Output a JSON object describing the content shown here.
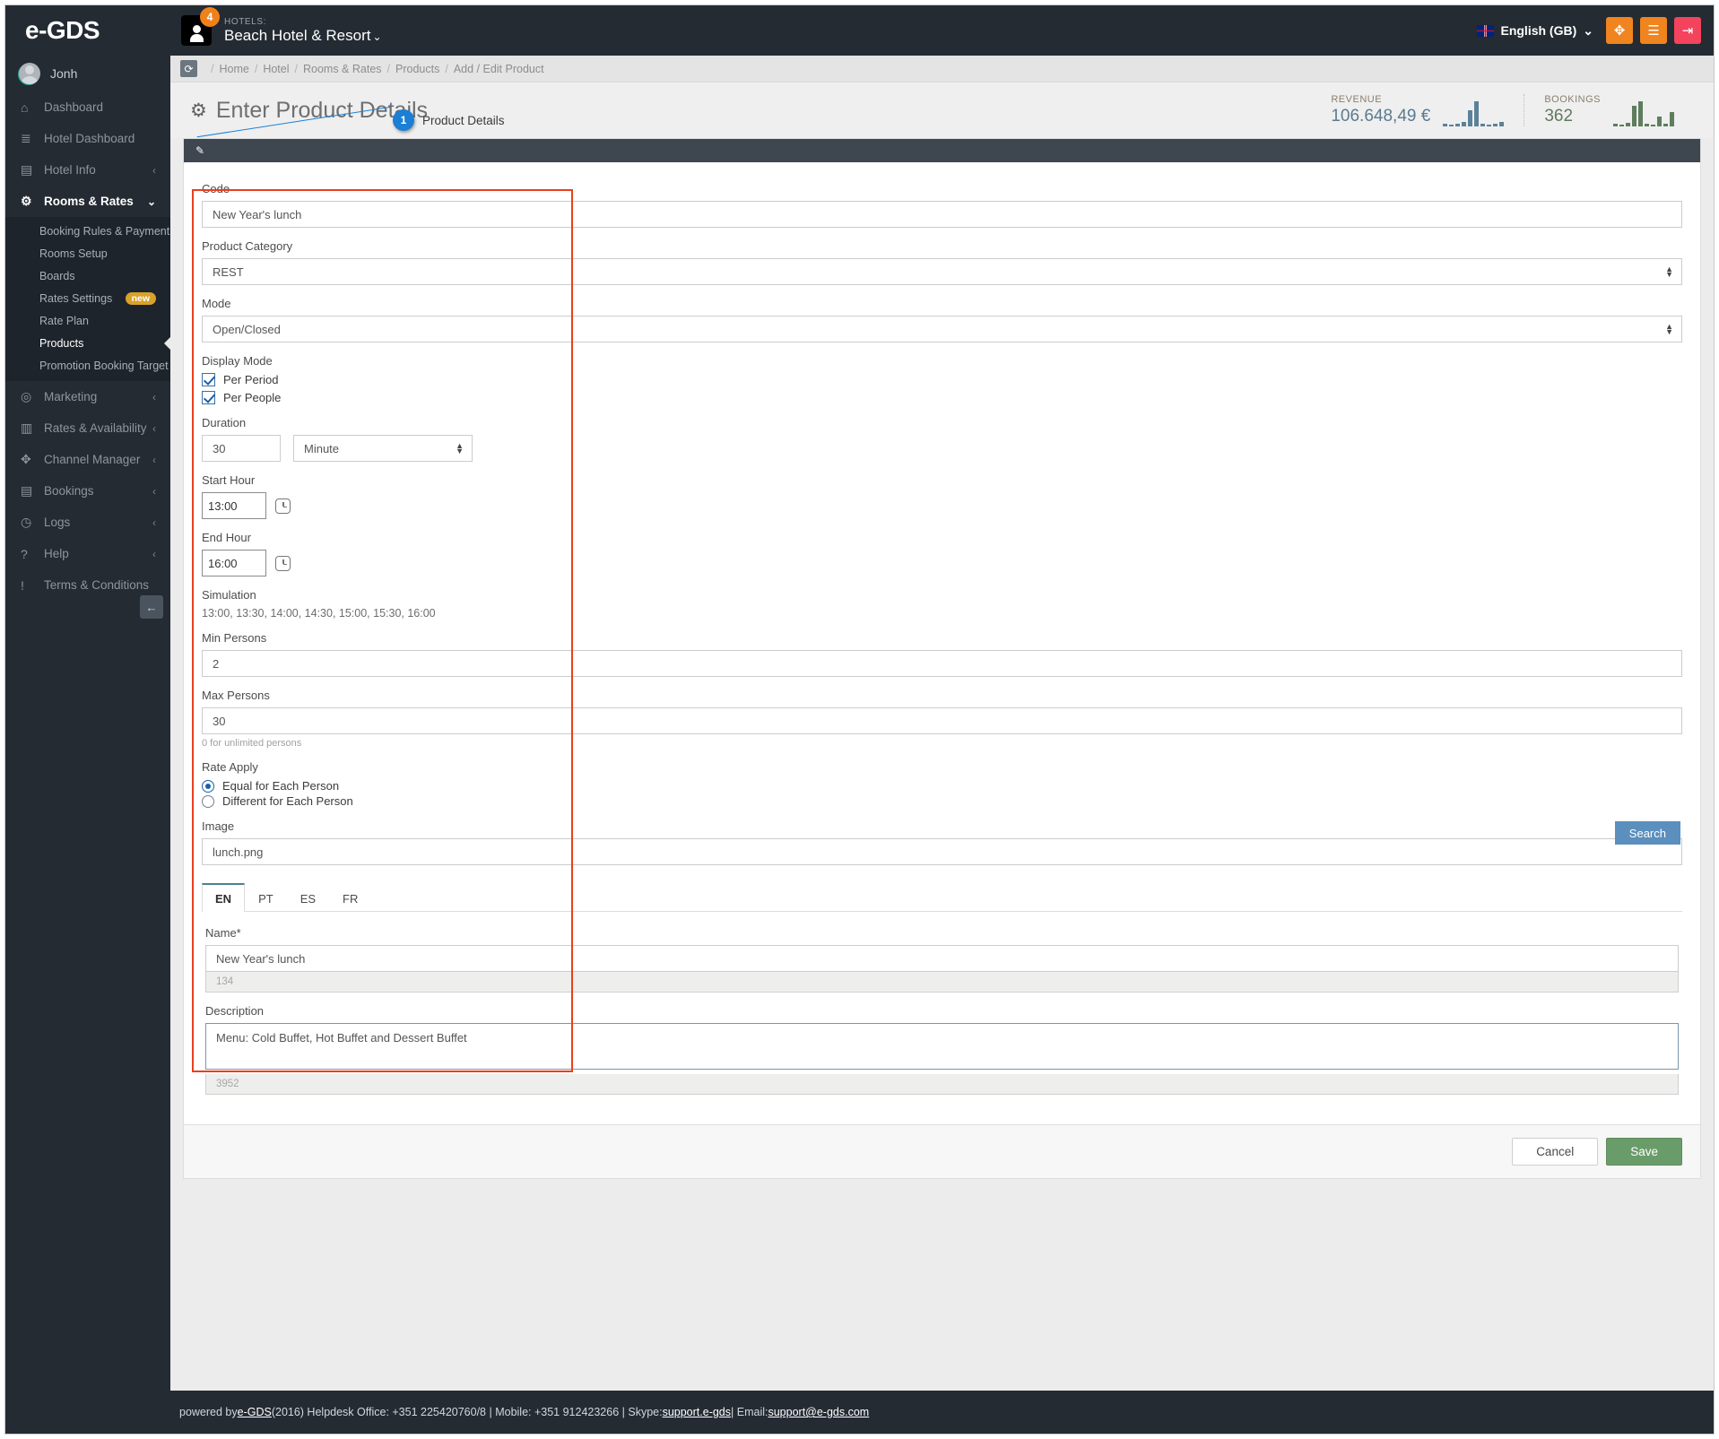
{
  "topbar": {
    "brand": "e-GDS",
    "notification_count": "4",
    "hotels_label": "HOTELS:",
    "hotel_name": "Beach Hotel & Resort",
    "hotel_caret": "⌄",
    "language": "English (GB)",
    "language_caret": "⌄",
    "fullscreen_icon": "✥",
    "menu_icon": "☰",
    "logout_icon": "⇥"
  },
  "sidebar": {
    "user": "Jonh",
    "items": [
      {
        "label": "Dashboard",
        "icon": "⌂",
        "arrow": "",
        "active": false
      },
      {
        "label": "Hotel Dashboard",
        "icon": "≣",
        "arrow": "",
        "active": false
      },
      {
        "label": "Hotel Info",
        "icon": "🏢",
        "arrow": "‹",
        "active": false
      },
      {
        "label": "Rooms & Rates",
        "icon": "⚙",
        "arrow": "⌄",
        "active": true
      }
    ],
    "submenu": [
      {
        "label": "Booking Rules & Payment",
        "badge": ""
      },
      {
        "label": "Rooms Setup",
        "badge": ""
      },
      {
        "label": "Boards",
        "badge": ""
      },
      {
        "label": "Rates Settings",
        "badge": "new"
      },
      {
        "label": "Rate Plan",
        "badge": ""
      },
      {
        "label": "Products",
        "badge": "",
        "current": true
      },
      {
        "label": "Promotion Booking Target",
        "badge": ""
      }
    ],
    "items_bottom": [
      {
        "label": "Marketing",
        "icon": "◎",
        "arrow": "‹"
      },
      {
        "label": "Rates & Availability",
        "icon": "▥",
        "arrow": "‹"
      },
      {
        "label": "Channel Manager",
        "icon": "✥",
        "arrow": "‹"
      },
      {
        "label": "Bookings",
        "icon": "🛒",
        "arrow": "‹"
      },
      {
        "label": "Logs",
        "icon": "◷",
        "arrow": "‹"
      },
      {
        "label": "Help",
        "icon": "❓",
        "arrow": "‹"
      },
      {
        "label": "Terms & Conditions",
        "icon": "❗",
        "arrow": ""
      }
    ],
    "collapse_icon": "←"
  },
  "breadcrumb": {
    "refresh_icon": "⟳",
    "items": [
      "Home",
      "Hotel",
      "Rooms & Rates",
      "Products",
      "Add / Edit Product"
    ],
    "separator": "/"
  },
  "page": {
    "title": "Enter Product Details",
    "title_icon": "⚙",
    "callout_number": "1",
    "callout_text": "Product Details",
    "panel_icon": "✎"
  },
  "stats": {
    "revenue_label": "REVENUE",
    "revenue_value": "106.648,49 €",
    "bookings_label": "BOOKINGS",
    "bookings_value": "362"
  },
  "chart_data": [
    {
      "type": "bar",
      "title": "REVENUE",
      "categories": [
        "1",
        "2",
        "3",
        "4",
        "5",
        "6",
        "7",
        "8",
        "9",
        "10"
      ],
      "values": [
        2,
        1,
        2,
        3,
        14,
        22,
        2,
        1,
        2,
        3
      ],
      "color": "#5b8299",
      "ylim": [
        0,
        24
      ],
      "xlabel": "",
      "ylabel": ""
    },
    {
      "type": "bar",
      "title": "BOOKINGS",
      "categories": [
        "1",
        "2",
        "3",
        "4",
        "5",
        "6",
        "7",
        "8",
        "9",
        "10"
      ],
      "values": [
        2,
        1,
        3,
        18,
        22,
        2,
        1,
        8,
        2,
        12
      ],
      "color": "#5d7e5d",
      "ylim": [
        0,
        24
      ],
      "xlabel": "",
      "ylabel": ""
    }
  ],
  "form": {
    "code_label": "Code",
    "code_value": "New Year's lunch",
    "category_label": "Product Category",
    "category_value": "REST",
    "mode_label": "Mode",
    "mode_value": "Open/Closed",
    "display_mode_label": "Display Mode",
    "per_period_label": "Per Period",
    "per_period_checked": true,
    "per_people_label": "Per People",
    "per_people_checked": true,
    "duration_label": "Duration",
    "duration_value": "30",
    "duration_unit": "Minute",
    "start_hour_label": "Start Hour",
    "start_hour_value": "13:00",
    "end_hour_label": "End Hour",
    "end_hour_value": "16:00",
    "simulation_label": "Simulation",
    "simulation_value": "13:00, 13:30, 14:00, 14:30, 15:00, 15:30, 16:00",
    "min_persons_label": "Min Persons",
    "min_persons_value": "2",
    "max_persons_label": "Max Persons",
    "max_persons_value": "30",
    "max_persons_hint": "0 for unlimited persons",
    "rate_apply_label": "Rate Apply",
    "rate_equal_label": "Equal for Each Person",
    "rate_different_label": "Different for Each Person",
    "image_label": "Image",
    "image_value": "lunch.png",
    "search_button": "Search"
  },
  "lang_tabs": [
    {
      "label": "EN",
      "active": true
    },
    {
      "label": "PT",
      "active": false
    },
    {
      "label": "ES",
      "active": false
    },
    {
      "label": "FR",
      "active": false
    }
  ],
  "translation": {
    "name_label": "Name*",
    "name_value": "New Year's lunch",
    "name_counter": "134",
    "description_label": "Description",
    "description_value": "Menu: Cold Buffet, Hot Buffet and Dessert Buffet",
    "description_counter": "3952"
  },
  "actions": {
    "cancel_label": "Cancel",
    "save_label": "Save"
  },
  "footer": {
    "prefix": "powered by ",
    "brand": "e-GDS",
    "middle": " (2016) Helpdesk Office: +351 225420760/8 | Mobile: +351 912423266 | Skype: ",
    "skype": "support.e-gds",
    "email_label": " | Email: ",
    "email": "support@e-gds.com"
  },
  "colors": {
    "dark": "#242b33",
    "orange": "#f0841e",
    "red": "#f4435c",
    "accent_blue": "#1b7fd4",
    "highlight_red": "#e8401e",
    "save_green": "#6a9c6a"
  }
}
